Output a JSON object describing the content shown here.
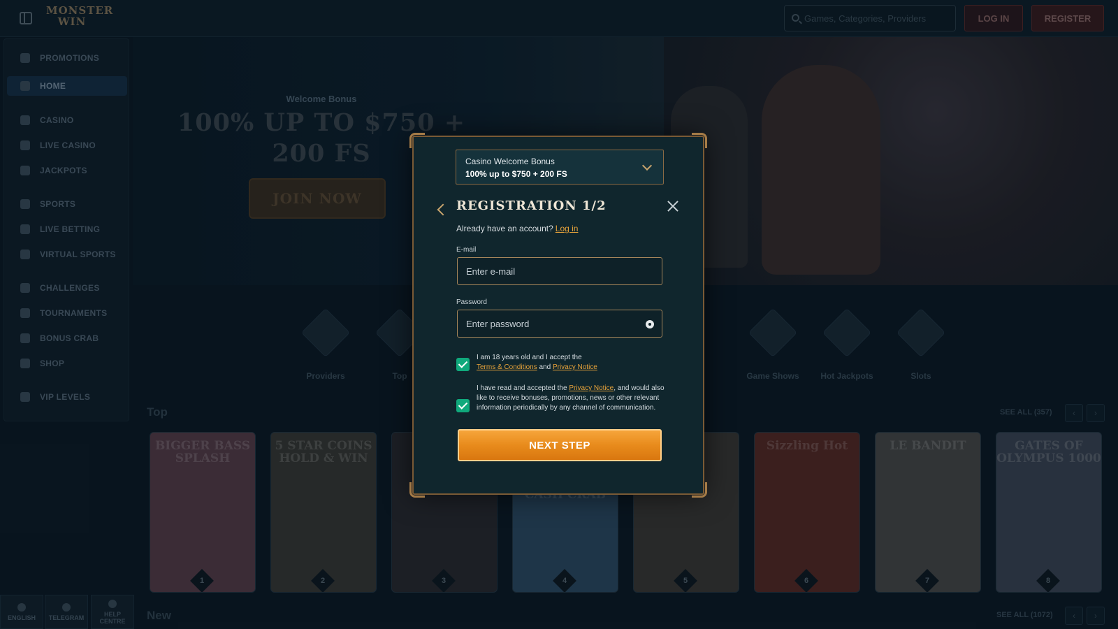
{
  "header": {
    "logo_text": "MONSTER WIN",
    "search_placeholder": "Games, Categories, Providers",
    "login_label": "LOG IN",
    "register_label": "REGISTER"
  },
  "sidebar": {
    "items": [
      {
        "label": "PROMOTIONS",
        "icon": "gift-icon"
      },
      {
        "label": "HOME",
        "icon": "home-icon",
        "active": true
      },
      {
        "label": "CASINO",
        "icon": "casino-icon"
      },
      {
        "label": "LIVE CASINO",
        "icon": "live-casino-icon"
      },
      {
        "label": "JACKPOTS",
        "icon": "jackpot-icon"
      },
      {
        "label": "SPORTS",
        "icon": "sports-icon"
      },
      {
        "label": "LIVE BETTING",
        "icon": "live-betting-icon"
      },
      {
        "label": "VIRTUAL SPORTS",
        "icon": "virtual-sports-icon"
      },
      {
        "label": "CHALLENGES",
        "icon": "challenges-icon"
      },
      {
        "label": "TOURNAMENTS",
        "icon": "tournaments-icon"
      },
      {
        "label": "BONUS CRAB",
        "icon": "bonus-crab-icon"
      },
      {
        "label": "SHOP",
        "icon": "shop-icon"
      },
      {
        "label": "VIP LEVELS",
        "icon": "vip-icon"
      }
    ],
    "footer": {
      "english": "ENGLISH",
      "telegram": "TELEGRAM",
      "help": "HELP CENTRE"
    }
  },
  "hero": {
    "welcome_small": "Welcome Bonus",
    "welcome_big": "100% UP TO $750 + 200 FS",
    "join_label": "JOIN NOW"
  },
  "categories": [
    {
      "label": "Providers"
    },
    {
      "label": "Top"
    },
    {
      "label": "Game Shows"
    },
    {
      "label": "Hot Jackpots"
    },
    {
      "label": "Slots"
    }
  ],
  "rows": {
    "top": {
      "title": "Top",
      "see_all": "SEE ALL (357)"
    },
    "new": {
      "title": "New",
      "see_all": "SEE ALL (1072)"
    }
  },
  "games": [
    {
      "title": "BIGGER BASS SPLASH",
      "rank": "1",
      "color": "#5a3e4a"
    },
    {
      "title": "5 STAR COINS HOLD & WIN",
      "rank": "2",
      "color": "#3a3a36"
    },
    {
      "title": "",
      "rank": "3",
      "color": "#2a2a30"
    },
    {
      "title": "CASH CRAB",
      "rank": "4",
      "color": "#2d4c66"
    },
    {
      "title": "",
      "rank": "5",
      "color": "#3c3a36"
    },
    {
      "title": "Sizzling Hot",
      "rank": "6",
      "color": "#5a2a26"
    },
    {
      "title": "LE BANDIT",
      "rank": "7",
      "color": "#4a4a4a"
    },
    {
      "title": "GATES OF OLYMPUS 1000",
      "rank": "8",
      "color": "#3d4656"
    }
  ],
  "modal": {
    "bonus_line1": "Casino Welcome Bonus",
    "bonus_line2": "100% up to $750 + 200 FS",
    "title": "REGISTRATION 1/2",
    "have_account": "Already have an account?",
    "login_link": "Log in",
    "email_label": "E-mail",
    "email_placeholder": "Enter e-mail",
    "password_label": "Password",
    "password_placeholder": "Enter password",
    "check1_text_a": "I am 18 years old and I accept the",
    "check1_link1": "Terms & Conditions",
    "check1_and": "and",
    "check1_link2": "Privacy Notice",
    "check2_text_a": "I have read and accepted the",
    "check2_link": "Privacy Notice",
    "check2_text_b": ", and would also like to receive bonuses, promotions, news or other relevant information periodically by any channel of communication.",
    "next_label": "NEXT STEP"
  }
}
